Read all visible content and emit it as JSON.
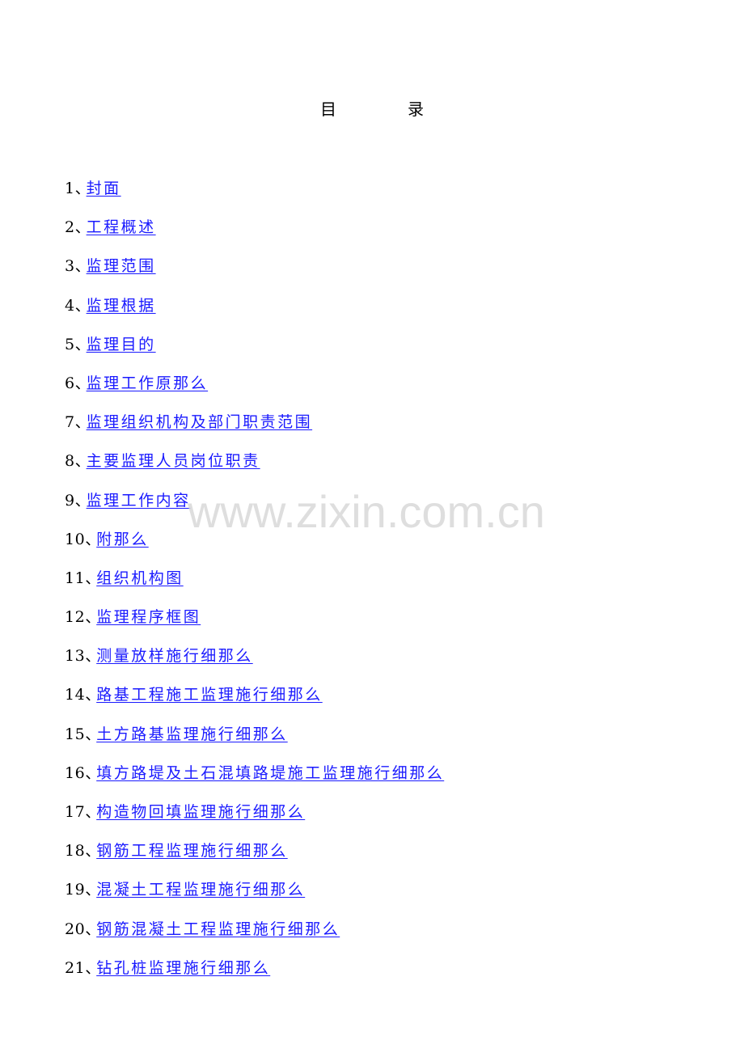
{
  "document": {
    "title_chars": [
      "目",
      "录"
    ],
    "toc": [
      {
        "number": "1",
        "separator": "、",
        "label": "封面"
      },
      {
        "number": "2",
        "separator": "、",
        "label": "工程概述"
      },
      {
        "number": "3",
        "separator": "、",
        "label": "监理范围"
      },
      {
        "number": "4",
        "separator": "、",
        "label": "监理根据"
      },
      {
        "number": "5",
        "separator": "、",
        "label": "监理目的"
      },
      {
        "number": "6",
        "separator": "、",
        "label": "监理工作原那么"
      },
      {
        "number": "7",
        "separator": "、",
        "label": "监理组织机构及部门职责范围"
      },
      {
        "number": "8",
        "separator": "、",
        "label": "主要监理人员岗位职责"
      },
      {
        "number": "9",
        "separator": "、",
        "label": "监理工作内容"
      },
      {
        "number": "10",
        "separator": "、",
        "label": "附那么"
      },
      {
        "number": "11",
        "separator": "、",
        "label": "组织机构图"
      },
      {
        "number": "12",
        "separator": "、",
        "label": "监理程序框图"
      },
      {
        "number": "13",
        "separator": "、",
        "label": "测量放样施行细那么"
      },
      {
        "number": "14",
        "separator": "、",
        "label": "路基工程施工监理施行细那么"
      },
      {
        "number": "15",
        "separator": "、",
        "label": "土方路基监理施行细那么"
      },
      {
        "number": "16",
        "separator": "、",
        "label": "填方路堤及土石混填路堤施工监理施行细那么"
      },
      {
        "number": "17",
        "separator": "、",
        "label": "构造物回填监理施行细那么"
      },
      {
        "number": "18",
        "separator": "、",
        "label": "钢筋工程监理施行细那么"
      },
      {
        "number": "19",
        "separator": "、",
        "label": "混凝土工程监理施行细那么"
      },
      {
        "number": "20",
        "separator": "、",
        "label": "钢筋混凝土工程监理施行细那么"
      },
      {
        "number": "21",
        "separator": "、",
        "label": "钻孔桩监理施行细那么"
      }
    ]
  },
  "watermark": {
    "text": "www.zixin.com.cn"
  },
  "colors": {
    "link": "#1a1aff",
    "watermark": "#d9d9d9",
    "text": "#000000"
  }
}
